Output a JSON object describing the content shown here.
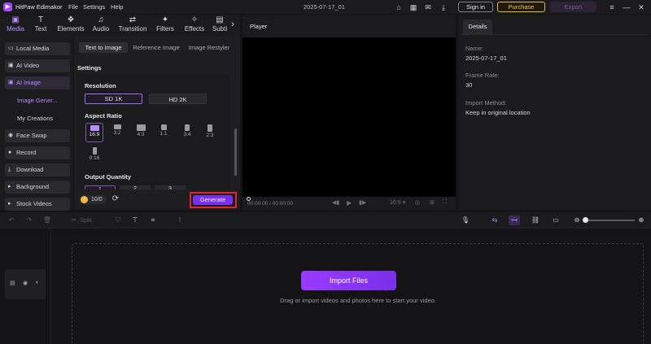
{
  "titlebar": {
    "app_name": "HitPaw Edimakor",
    "menus": [
      "File",
      "Settings",
      "Help"
    ],
    "project_title": "2025-07-17_01",
    "sign_in": "Sign in",
    "purchase": "Purchase",
    "export": "Export"
  },
  "toptabs": [
    {
      "label": "Media",
      "icon": "media-icon",
      "glyph": "▣"
    },
    {
      "label": "Text",
      "icon": "text-icon",
      "glyph": "T"
    },
    {
      "label": "Elements",
      "icon": "elements-icon",
      "glyph": "❖"
    },
    {
      "label": "Audio",
      "icon": "audio-icon",
      "glyph": "♫"
    },
    {
      "label": "Transition",
      "icon": "transition-icon",
      "glyph": "⇄"
    },
    {
      "label": "Filters",
      "icon": "filters-icon",
      "glyph": "✦"
    },
    {
      "label": "Effects",
      "icon": "effects-icon",
      "glyph": "✧"
    },
    {
      "label": "Subti",
      "icon": "subtitles-icon",
      "glyph": "▤"
    }
  ],
  "sidebar": {
    "items": [
      {
        "label": "Local Media",
        "glyph": "▭"
      },
      {
        "label": "AI Video",
        "glyph": "▣"
      },
      {
        "label": "AI Image",
        "glyph": "▣"
      },
      {
        "label": "Face Swap",
        "glyph": "◉"
      },
      {
        "label": "Record",
        "glyph": "●"
      },
      {
        "label": "Download",
        "glyph": "⤓"
      },
      {
        "label": "Background",
        "glyph": "▸"
      },
      {
        "label": "Stock Videos",
        "glyph": "▸"
      }
    ],
    "sub_items": [
      "Image Gener...",
      "My Creations"
    ]
  },
  "t2i": {
    "tabs": [
      "Text to Image",
      "Reference Image",
      "Image Restyler"
    ],
    "settings_label": "Settings",
    "resolution_label": "Resolution",
    "resolutions": [
      "SD 1K",
      "HD 2K"
    ],
    "aspect_label": "Aspect Ratio",
    "ratios": [
      "16:9",
      "3:2",
      "4:3",
      "1:1",
      "3:4",
      "2:3",
      "9:16"
    ],
    "output_label": "Output Quantity",
    "quantities": [
      "1",
      "2",
      "3"
    ],
    "credits": "10/0",
    "generate": "Generate"
  },
  "player": {
    "title": "Player",
    "time": "00:00:00 / 00:00:00",
    "ratio": "16:9"
  },
  "details": {
    "tab": "Details",
    "name_label": "Name:",
    "name_value": "2025-07-17_01",
    "fps_label": "Frame Rate:",
    "fps_value": "30",
    "import_label": "Import Method:",
    "import_value": "Keep in original location"
  },
  "timeline": {
    "split": "Split",
    "import_button": "Import Files",
    "drop_hint": "Drag or import videos and photos here to start your video."
  },
  "colors": {
    "accent": "#b98cff",
    "generate": "#7a2fe8",
    "purchase": "#f1c45b",
    "highlight_frame": "#e0252b"
  }
}
